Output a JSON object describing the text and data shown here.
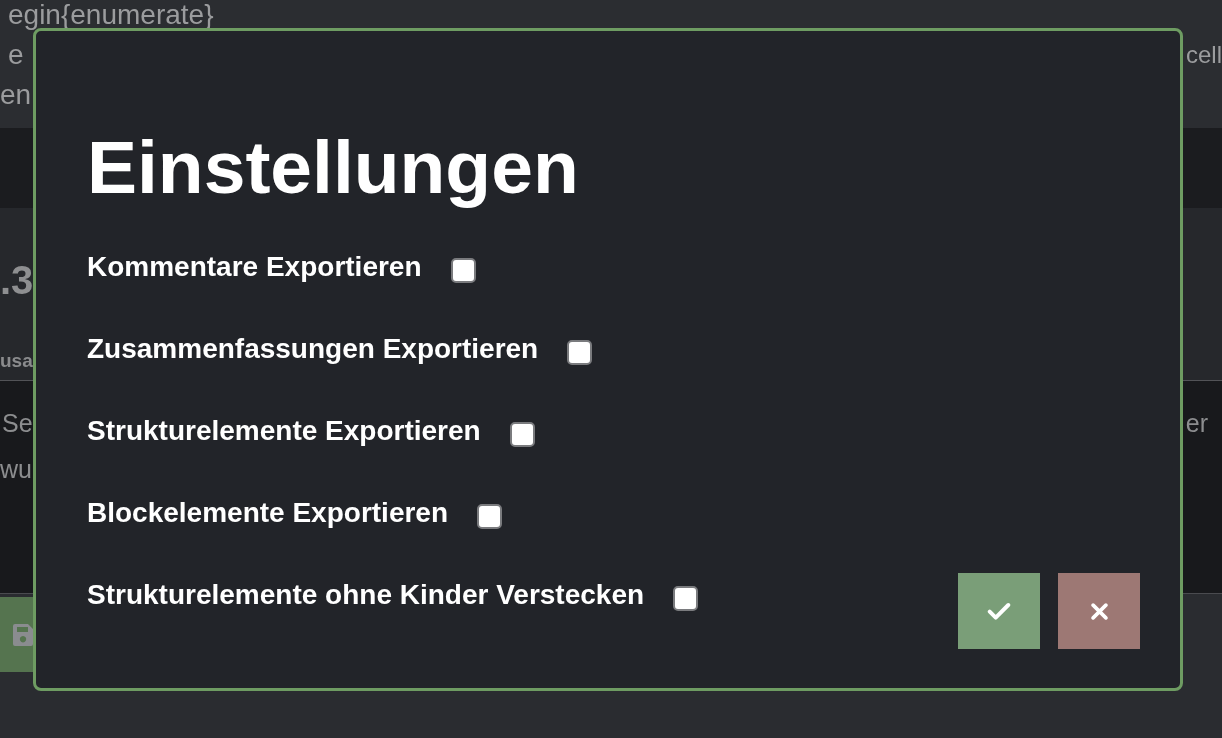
{
  "background": {
    "code_lines": [
      {
        "text": "egin{enumerate}"
      },
      {
        "text": "e",
        "right_text": "cell"
      },
      {
        "text": "en"
      }
    ],
    "heading": ".3",
    "subheading": "usa",
    "paragraph_lines": [
      {
        "text": "Se",
        "right_text": "er"
      },
      {
        "text": "wu"
      }
    ],
    "toolbar": {
      "buttons": [
        {
          "kind": "save"
        }
      ]
    }
  },
  "dialog": {
    "title": "Einstellungen",
    "options": [
      {
        "label": "Kommentare Exportieren",
        "checked": false
      },
      {
        "label": "Zusammenfassungen Exportieren",
        "checked": false
      },
      {
        "label": "Strukturelemente Exportieren",
        "checked": false
      },
      {
        "label": "Blockelemente Exportieren",
        "checked": false
      },
      {
        "label": "Strukturelemente ohne Kinder Verstecken",
        "checked": false
      }
    ],
    "buttons": [
      {
        "kind": "confirm"
      },
      {
        "kind": "cancel"
      }
    ]
  }
}
